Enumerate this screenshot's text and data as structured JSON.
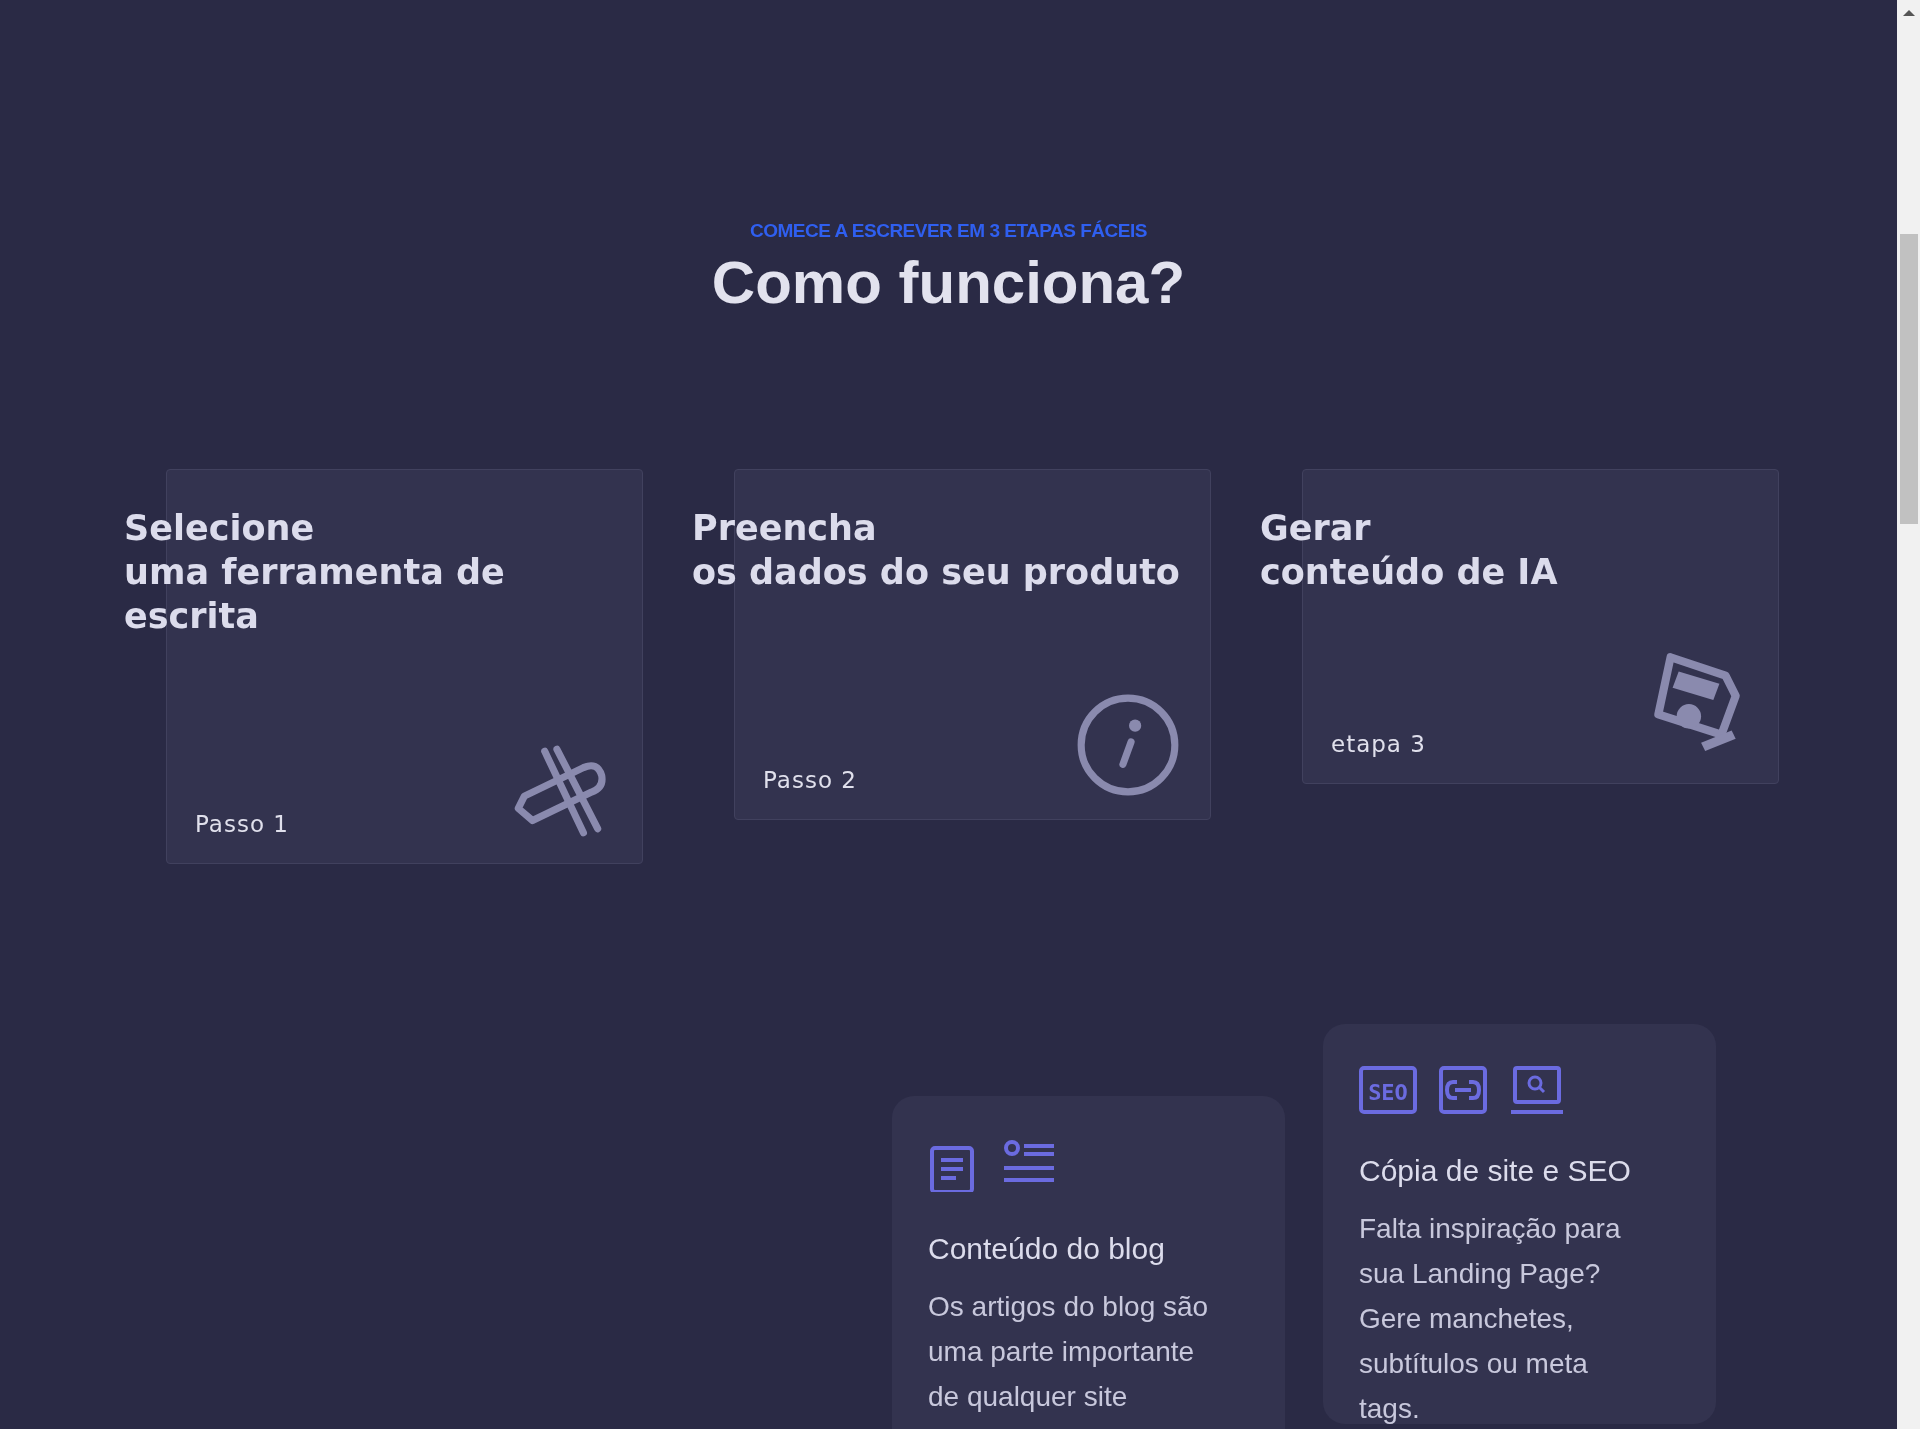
{
  "section": {
    "eyebrow": "COMECE A ESCREVER EM 3 ETAPAS FÁCEIS",
    "title": "Como funciona?"
  },
  "steps": [
    {
      "title_lines": [
        "Selecione",
        "uma ferramenta de",
        "escrita"
      ],
      "step_label": "Passo 1",
      "kind": "tools"
    },
    {
      "title_lines": [
        "Preencha",
        "os dados do seu produto"
      ],
      "step_label": "Passo 2",
      "kind": "info"
    },
    {
      "title_lines": [
        "Gerar",
        "conteúdo de IA"
      ],
      "step_label": "etapa 3",
      "kind": "disk"
    }
  ],
  "features": [
    {
      "icons": [
        {
          "kind": "document"
        },
        {
          "kind": "list"
        }
      ],
      "title": "Conteúdo do blog",
      "text": "Os artigos do blog são uma parte importante de qualquer site"
    },
    {
      "icons": [
        {
          "kind": "badge",
          "label": "SEO"
        },
        {
          "kind": "link"
        },
        {
          "kind": "laptop-search"
        }
      ],
      "title": "Cópia de site e SEO",
      "text": "Falta inspiração para sua Landing Page? Gere manchetes, subtítulos ou meta tags."
    }
  ]
}
